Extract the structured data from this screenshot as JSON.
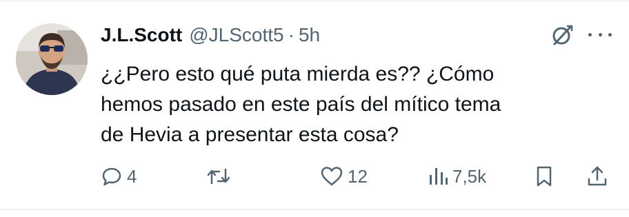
{
  "tweet": {
    "display_name": "J.L.Scott",
    "handle": "@JLScott5",
    "separator": "·",
    "time": "5h",
    "text": "¿¿Pero esto qué puta mierda es?? ¿Cómo\nhemos pasado en este país del mítico tema\nde Hevia a presentar esta cosa?"
  },
  "actions": {
    "reply_count": "4",
    "retweet_count": "",
    "like_count": "12",
    "views_count": "7,5k"
  },
  "icons": {
    "reply": "reply-icon",
    "retweet": "retweet-icon",
    "like": "heart-icon",
    "views": "views-icon",
    "bookmark": "bookmark-icon",
    "share": "share-icon",
    "grok": "grok-icon",
    "more": "more-icon"
  },
  "colors": {
    "text": "#0f1419",
    "secondary": "#536471",
    "divider": "#eff3f4"
  }
}
